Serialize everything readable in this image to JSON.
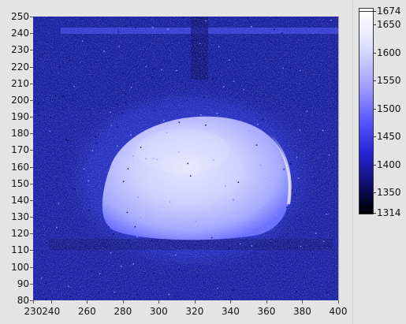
{
  "chart_data": {
    "type": "heatmap",
    "x_ticks": [
      "230",
      "240",
      "260",
      "280",
      "300",
      "320",
      "340",
      "360",
      "380",
      "400"
    ],
    "y_ticks": [
      "250",
      "240",
      "230",
      "220",
      "210",
      "200",
      "190",
      "180",
      "170",
      "160",
      "150",
      "140",
      "130",
      "120",
      "110",
      "100",
      "90",
      "80"
    ],
    "xlim": [
      230,
      400
    ],
    "ylim": [
      80,
      250
    ],
    "colorbar": {
      "ticks": [
        "1674",
        "1650",
        "1600",
        "1550",
        "1500",
        "1450",
        "1400",
        "1350",
        "1314"
      ],
      "range": [
        1314,
        1674
      ],
      "colormap": [
        "#000000",
        "#121278",
        "#2424d6",
        "#5050ff",
        "#9b9bff",
        "#dcdcff",
        "#ffffff"
      ]
    },
    "features": {
      "bright_blob": {
        "x_range": [
          272,
          372
        ],
        "y_range": [
          117,
          193
        ],
        "intensity_approx": 1560
      },
      "halo_intensity_approx": 1430,
      "background_intensity_approx": 1380,
      "horizontal_streak_y": 243
    }
  }
}
